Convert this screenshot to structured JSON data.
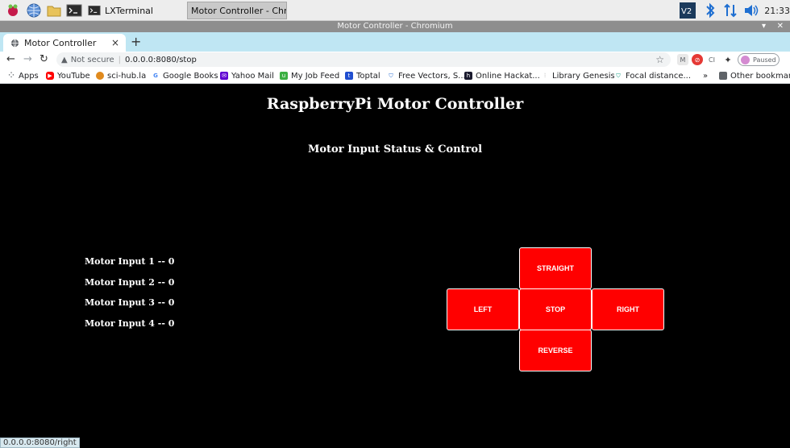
{
  "taskbar": {
    "tasks": [
      "LXTerminal",
      "Motor Controller - Chr..."
    ],
    "clock": "21:33"
  },
  "window": {
    "title": "Motor Controller - Chromium"
  },
  "tab": {
    "title": "Motor Controller",
    "close": "×",
    "new_tab": "+"
  },
  "toolbar": {
    "security": "Not secure",
    "url": "0.0.0.0:8080/stop",
    "profile_status": "Paused"
  },
  "bookmarks": {
    "items": [
      "Apps",
      "YouTube",
      "sci-hub.la",
      "Google Books",
      "Yahoo Mail",
      "My Job Feed",
      "Toptal",
      "Free Vectors, S...",
      "Online Hackat...",
      "Library Genesis",
      "Focal distance..."
    ],
    "overflow": "»",
    "other": "Other bookmarks"
  },
  "page": {
    "title": "RaspberryPi Motor Controller",
    "subtitle": "Motor Input Status & Control",
    "motor_inputs": [
      "Motor Input 1 -- 0",
      "Motor Input 2 -- 0",
      "Motor Input 3 -- 0",
      "Motor Input 4 -- 0"
    ],
    "controls": {
      "straight": "STRAIGHT",
      "left": "LEFT",
      "stop": "STOP",
      "right": "RIGHT",
      "reverse": "REVERSE"
    },
    "button_color": "#ff0000"
  },
  "status_url": "0.0.0.0:8080/right"
}
